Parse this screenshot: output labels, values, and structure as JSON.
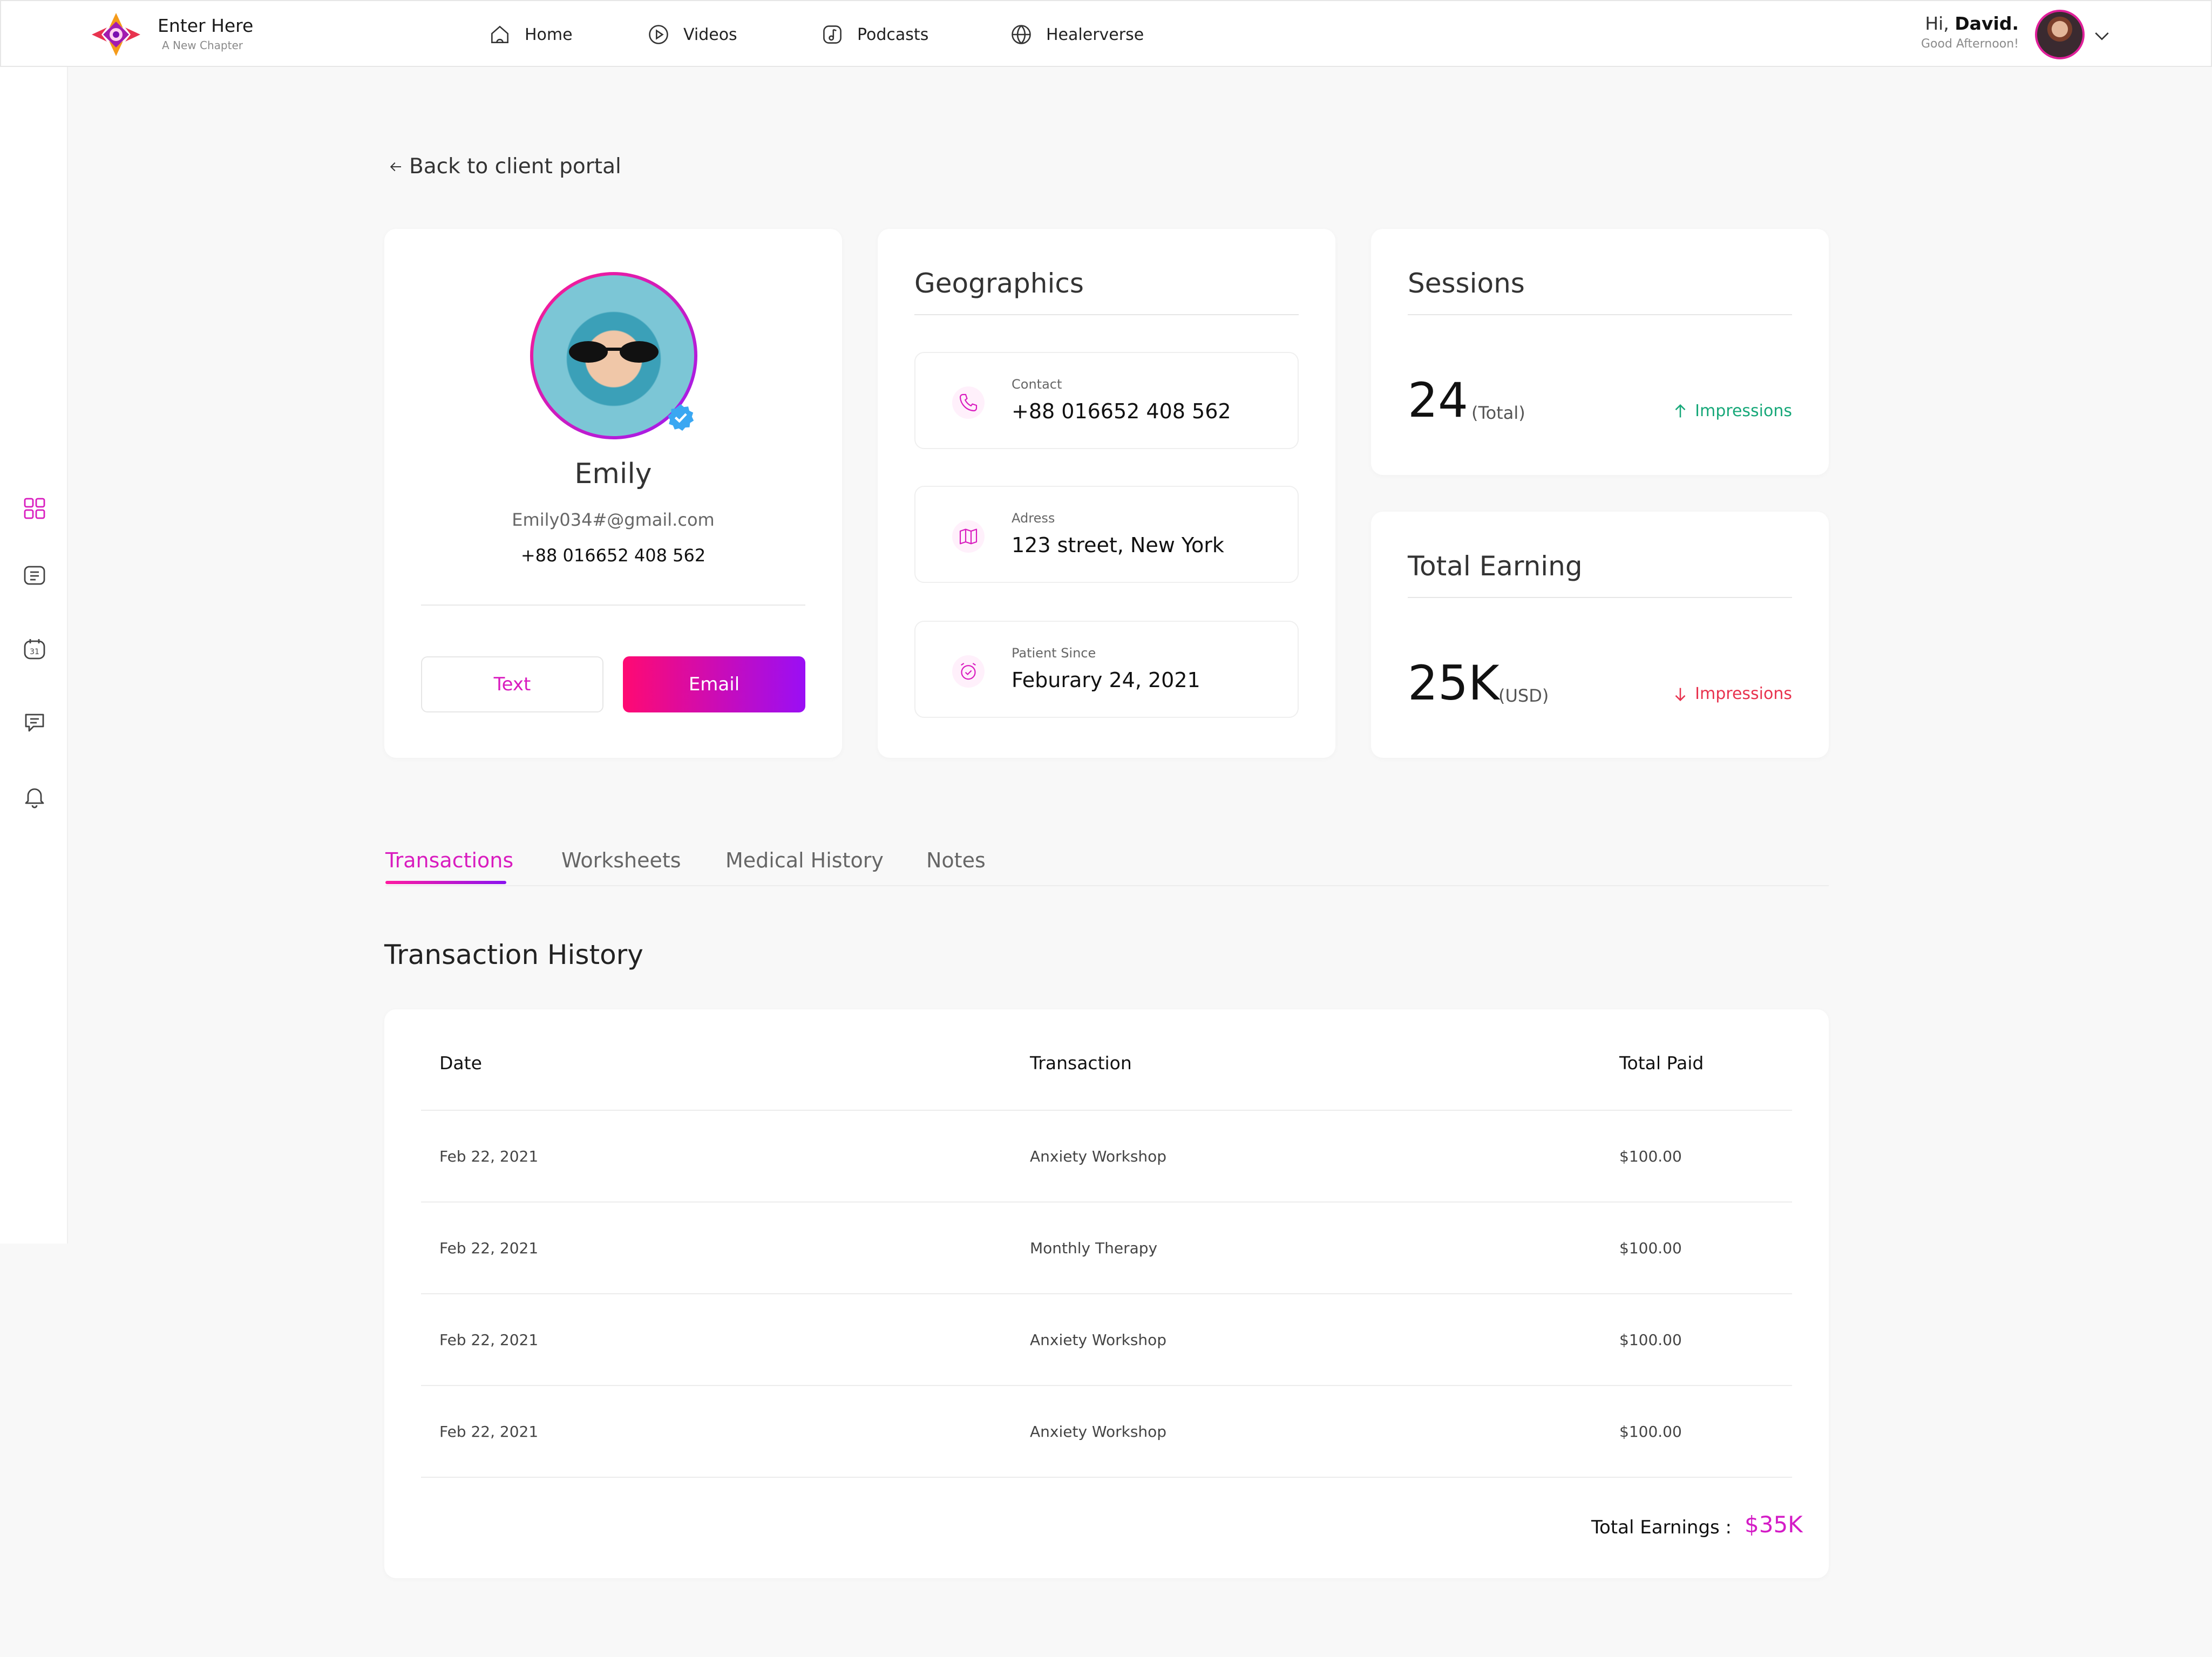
{
  "header": {
    "brand_title": "Enter Here",
    "brand_subtitle": "A New Chapter",
    "nav": [
      {
        "label": "Home",
        "icon": "home-icon"
      },
      {
        "label": "Videos",
        "icon": "play-icon"
      },
      {
        "label": "Podcasts",
        "icon": "music-note-icon"
      },
      {
        "label": "Healerverse",
        "icon": "globe-icon"
      }
    ],
    "greeting_prefix": "Hi,",
    "greeting_name": "David.",
    "greeting_sub": "Good Afternoon!"
  },
  "sidebar": {
    "icons": [
      "dashboard-grid-icon",
      "list-icon",
      "calendar-icon",
      "chat-icon",
      "bell-icon"
    ]
  },
  "back_link": "Back to client portal",
  "profile": {
    "name": "Emily",
    "email": "Emily034#@gmail.com",
    "phone": "+88 016652 408 562",
    "text_button": "Text",
    "email_button": "Email"
  },
  "geographics": {
    "title": "Geographics",
    "items": [
      {
        "label": "Contact",
        "value": "+88 016652 408 562",
        "icon": "phone-icon"
      },
      {
        "label": "Adress",
        "value": "123 street, New York",
        "icon": "map-icon"
      },
      {
        "label": "Patient Since",
        "value": "Feburary 24, 2021",
        "icon": "alarm-check-icon"
      }
    ]
  },
  "sessions": {
    "title": "Sessions",
    "value": "24",
    "unit": "(Total)",
    "trend_label": "Impressions",
    "trend_color": "#17a879"
  },
  "earnings": {
    "title": "Total Earning",
    "value": "25K",
    "unit": "(USD)",
    "trend_label": "Impressions",
    "trend_color": "#e8334f"
  },
  "tabs": [
    "Transactions",
    "Worksheets",
    "Medical History",
    "Notes"
  ],
  "active_tab": "Transactions",
  "history": {
    "title": "Transaction History",
    "columns": [
      "Date",
      "Transaction",
      "Total Paid"
    ],
    "rows": [
      [
        "Feb 22, 2021",
        "Anxiety Workshop",
        "$100.00"
      ],
      [
        "Feb 22, 2021",
        "Monthly Therapy",
        "$100.00"
      ],
      [
        "Feb 22, 2021",
        "Anxiety Workshop",
        "$100.00"
      ],
      [
        "Feb 22, 2021",
        "Anxiety Workshop",
        "$100.00"
      ]
    ],
    "total_label": "Total Earnings :",
    "total_value": "$35K"
  },
  "colors": {
    "accent_pink": "#d91cbf",
    "gradient_start": "#ff0a72",
    "gradient_end": "#9a0ef5"
  }
}
